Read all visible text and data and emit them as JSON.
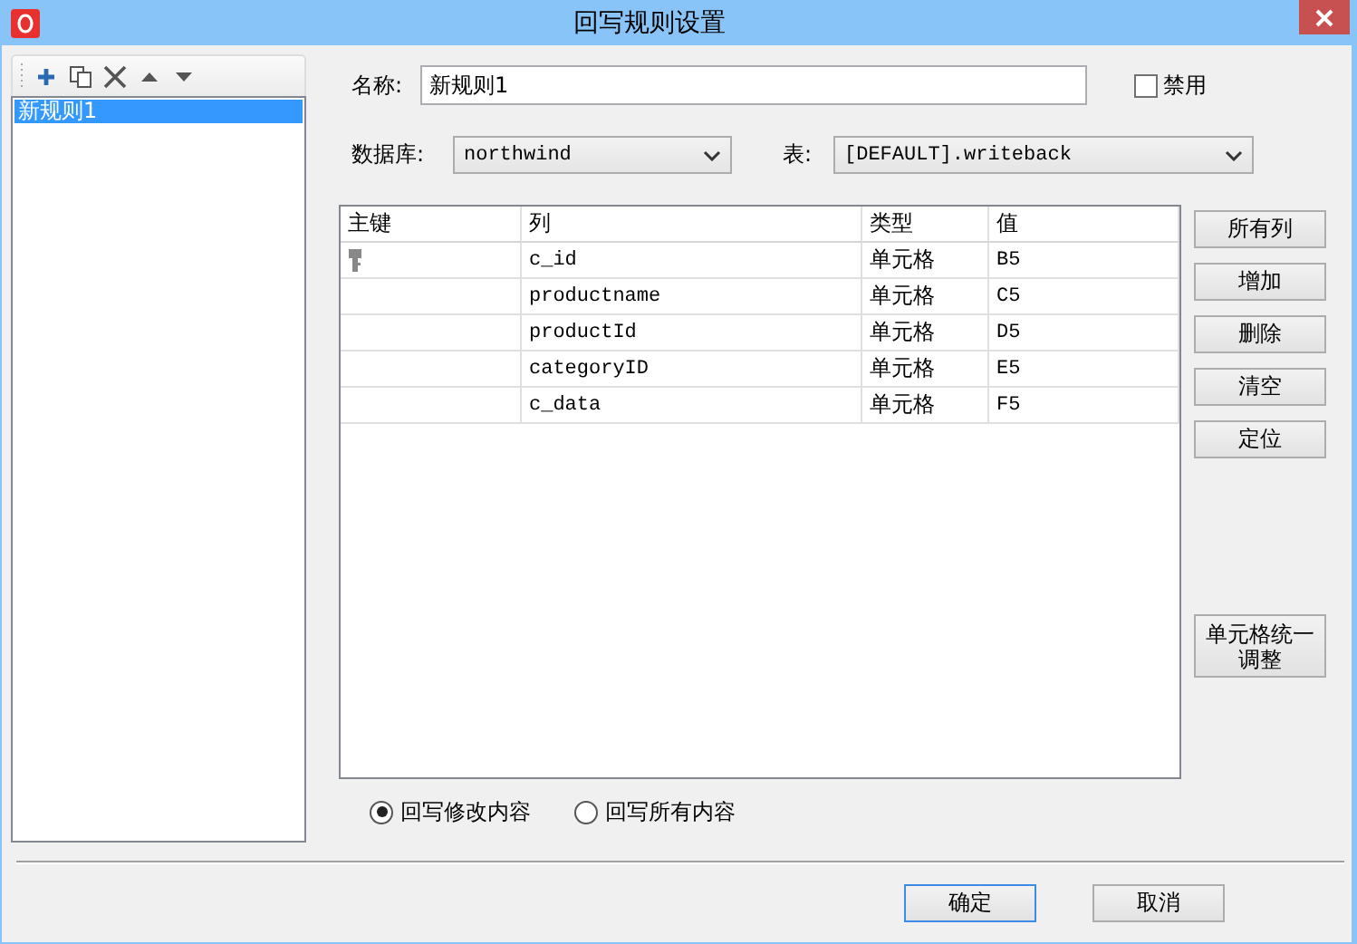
{
  "window": {
    "title": "回写规则设置"
  },
  "rules": [
    {
      "label": "新规则1",
      "selected": true
    }
  ],
  "name": {
    "label": "名称:",
    "value": "新规则1"
  },
  "disable": {
    "label": "禁用",
    "checked": false
  },
  "database": {
    "label": "数据库:",
    "value": "northwind"
  },
  "table_select": {
    "label": "表:",
    "value": "[DEFAULT].writeback"
  },
  "grid": {
    "columns": [
      "主键",
      "列",
      "类型",
      "值"
    ],
    "rows": [
      {
        "primary_key": true,
        "column": "c_id",
        "type": "单元格",
        "value": "B5"
      },
      {
        "primary_key": false,
        "column": "productname",
        "type": "单元格",
        "value": "C5"
      },
      {
        "primary_key": false,
        "column": "productId",
        "type": "单元格",
        "value": "D5"
      },
      {
        "primary_key": false,
        "column": "categoryID",
        "type": "单元格",
        "value": "E5"
      },
      {
        "primary_key": false,
        "column": "c_data",
        "type": "单元格",
        "value": "F5"
      }
    ]
  },
  "side_buttons": [
    "所有列",
    "增加",
    "删除",
    "清空",
    "定位"
  ],
  "unify_button": "单元格统一调整",
  "modes": [
    {
      "label": "回写修改内容",
      "selected": true
    },
    {
      "label": "回写所有内容",
      "selected": false
    }
  ],
  "footer_buttons": [
    {
      "label": "确定",
      "default": true
    },
    {
      "label": "取消",
      "default": false
    }
  ]
}
